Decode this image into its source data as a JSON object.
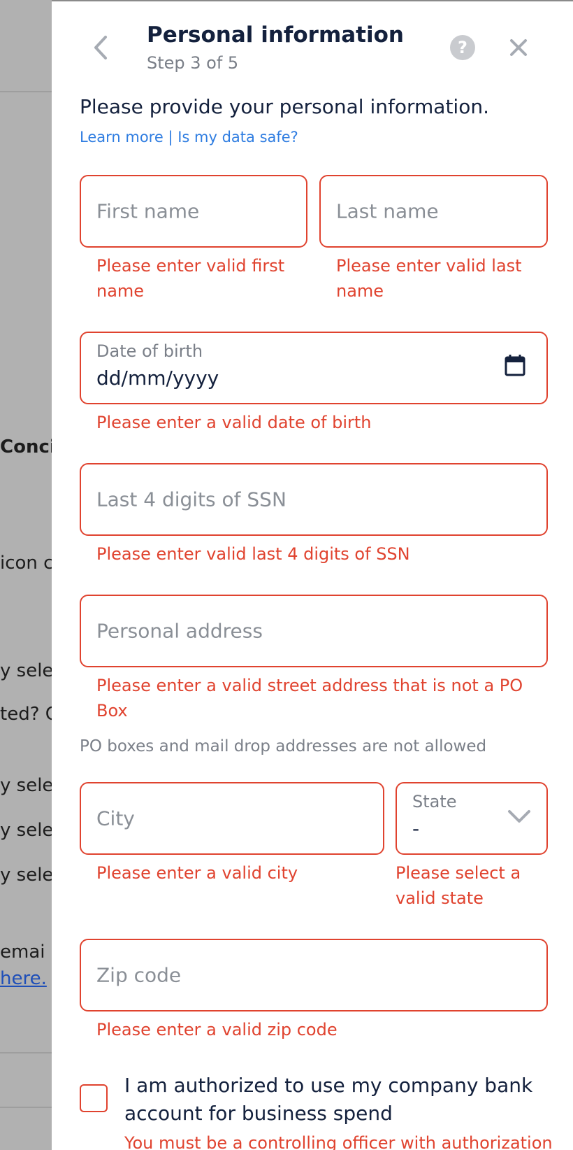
{
  "background": {
    "heading_fragment": "Conci",
    "text_fragments": [
      "icon c",
      "y sele",
      "ted? C",
      "y sele",
      "y sele",
      "y sele",
      " emai"
    ],
    "link_fragment": "here."
  },
  "header": {
    "title": "Personal information",
    "step": "Step 3 of 5",
    "help_glyph": "?"
  },
  "intro": {
    "text": "Please provide your personal information.",
    "learn_more": "Learn more",
    "separator": "|",
    "data_safe": "Is my data safe?"
  },
  "form": {
    "first_name": {
      "placeholder": "First name",
      "error": "Please enter valid first name"
    },
    "last_name": {
      "placeholder": "Last name",
      "error": "Please enter valid last name"
    },
    "dob": {
      "label": "Date of birth",
      "value": "dd/mm/yyyy",
      "error": "Please enter a valid date of birth"
    },
    "ssn": {
      "placeholder": "Last 4 digits of SSN",
      "error": "Please enter valid last 4 digits of SSN"
    },
    "address": {
      "placeholder": "Personal address",
      "error": "Please enter a valid street address that is not a PO Box",
      "note": "PO boxes and mail drop addresses are not allowed"
    },
    "city": {
      "placeholder": "City",
      "error": "Please enter a valid city"
    },
    "state": {
      "label": "State",
      "value": "-",
      "error": "Please select a valid state"
    },
    "zip": {
      "placeholder": "Zip code",
      "error": "Please enter a valid zip code"
    },
    "authorization": {
      "label": "I am authorized to use my company bank account for business spend",
      "error": "You must be a controlling officer with authorization"
    }
  },
  "colors": {
    "error": "#e0432f",
    "link": "#2f7de1",
    "title": "#14213d"
  }
}
